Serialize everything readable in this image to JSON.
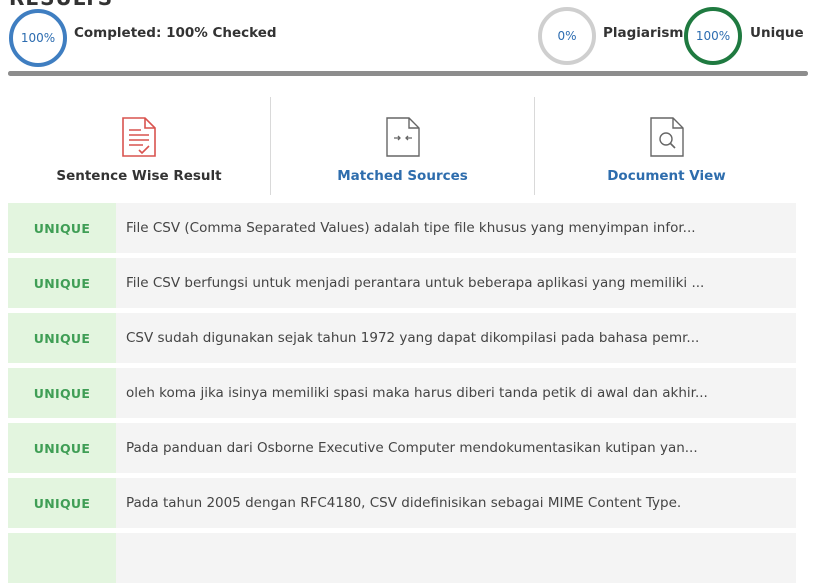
{
  "header": {
    "title": "RESULTS"
  },
  "summary": {
    "completed_pct": "100%",
    "completed_label": "Completed: 100% Checked",
    "plagiarism_pct": "0%",
    "plagiarism_label": "Plagiarism",
    "unique_pct": "100%",
    "unique_label": "Unique",
    "progress_fraction": 1.0
  },
  "tabs": [
    {
      "label": "Sentence Wise Result",
      "icon": "document-check-icon",
      "active": true
    },
    {
      "label": "Matched Sources",
      "icon": "document-compare-icon",
      "active": false
    },
    {
      "label": "Document View",
      "icon": "document-search-icon",
      "active": false
    }
  ],
  "results": [
    {
      "status": "UNIQUE",
      "text": "File CSV (Comma Separated Values) adalah tipe file khusus yang menyimpan infor..."
    },
    {
      "status": "UNIQUE",
      "text": "File CSV berfungsi untuk menjadi perantara untuk beberapa aplikasi yang memiliki ..."
    },
    {
      "status": "UNIQUE",
      "text": "CSV sudah digunakan sejak tahun 1972 yang dapat dikompilasi pada bahasa pemr..."
    },
    {
      "status": "UNIQUE",
      "text": "oleh koma jika isinya memiliki spasi maka harus diberi tanda petik di awal dan akhir..."
    },
    {
      "status": "UNIQUE",
      "text": "Pada panduan dari Osborne Executive Computer mendokumentasikan kutipan yan..."
    },
    {
      "status": "UNIQUE",
      "text": "Pada tahun 2005 dengan RFC4180, CSV didefinisikan sebagai MIME Content Type."
    }
  ],
  "colors": {
    "completed_ring": "#3f7ec1",
    "plagiarism_ring": "#cfcfcf",
    "unique_ring": "#1f7a40",
    "unique_badge_bg": "#e3f5df",
    "unique_badge_text": "#3f9e55",
    "link": "#2e6dad"
  }
}
